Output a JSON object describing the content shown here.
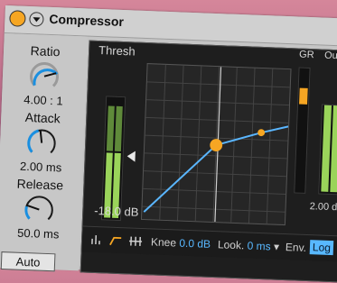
{
  "window": {
    "title": "Compressor"
  },
  "left": {
    "ratio": {
      "label": "Ratio",
      "value": "4.00 : 1"
    },
    "attack": {
      "label": "Attack",
      "value": "2.00 ms"
    },
    "release": {
      "label": "Release",
      "value": "50.0 ms"
    },
    "auto_label": "Auto"
  },
  "display": {
    "thresh_label": "Thresh",
    "thresh_value": "-18.0 dB",
    "gr_label": "GR",
    "out_label": "Out",
    "out_value": "2.00 d"
  },
  "bottom": {
    "knee_label": "Knee",
    "knee_value": "0.0 dB",
    "look_label": "Look.",
    "look_value": "0 ms",
    "env_label": "Env.",
    "env_value": "Log"
  },
  "colors": {
    "accent": "#f6a623",
    "meter_green": "#9ad45a",
    "curve_blue": "#5ab6ff",
    "value_blue": "#58b8ff"
  }
}
